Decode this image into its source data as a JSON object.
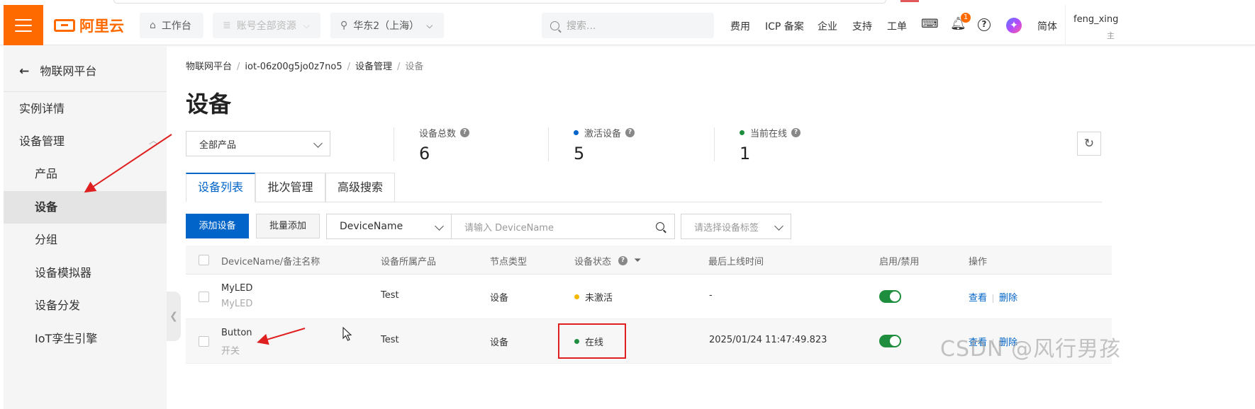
{
  "header": {
    "logo_text": "阿里云",
    "workbench": "工作台",
    "resources": "账号全部资源",
    "region": "华东2（上海）",
    "search_placeholder": "搜索...",
    "links": [
      "费用",
      "ICP 备案",
      "企业",
      "支持",
      "工单"
    ],
    "bell_count": "1",
    "help_glyph": "?",
    "language": "简体",
    "user_name": "feng_xing",
    "user_sub": "主"
  },
  "sidebar": {
    "back_label": "物联网平台",
    "items": [
      {
        "label": "实例详情"
      },
      {
        "label": "设备管理"
      },
      {
        "label": "产品"
      },
      {
        "label": "设备"
      },
      {
        "label": "分组"
      },
      {
        "label": "设备模拟器"
      },
      {
        "label": "设备分发"
      },
      {
        "label": "IoT孪生引擎"
      }
    ]
  },
  "breadcrumb": [
    "物联网平台",
    "iot-06z00g5jo0z7no5",
    "设备管理",
    "设备"
  ],
  "page_title": "设备",
  "product_select": "全部产品",
  "stats": [
    {
      "label": "设备总数",
      "value": "6",
      "dot_color": ""
    },
    {
      "label": "激活设备",
      "value": "5",
      "dot_color": "#0064c8"
    },
    {
      "label": "当前在线",
      "value": "1",
      "dot_color": "#1e8e3e"
    }
  ],
  "tabs": [
    "设备列表",
    "批次管理",
    "高级搜索"
  ],
  "toolbar": {
    "add_device": "添加设备",
    "batch_add": "批量添加",
    "field_select": "DeviceName",
    "search_placeholder": "请输入 DeviceName",
    "tag_placeholder": "请选择设备标签"
  },
  "table": {
    "columns": [
      "DeviceName/备注名称",
      "设备所属产品",
      "节点类型",
      "设备状态",
      "最后上线时间",
      "启用/禁用",
      "操作"
    ],
    "rows": [
      {
        "name": "MyLED",
        "note": "MyLED",
        "product": "Test",
        "node_type": "设备",
        "status": "未激活",
        "status_color": "#f5b800",
        "last_online": "-",
        "enabled": true,
        "actions": [
          "查看",
          "删除"
        ]
      },
      {
        "name": "Button",
        "note": "开关",
        "product": "Test",
        "node_type": "设备",
        "status": "在线",
        "status_color": "#1e8e3e",
        "last_online": "2025/01/24 11:47:49.823",
        "enabled": true,
        "actions": [
          "查看",
          "删除"
        ]
      }
    ]
  },
  "watermark": "CSDN @风行男孩",
  "colors": {
    "brand": "#ff6a00",
    "primary": "#0064c8",
    "online": "#1e8e3e",
    "inactive": "#f5b800",
    "annotation": "#e02020"
  }
}
